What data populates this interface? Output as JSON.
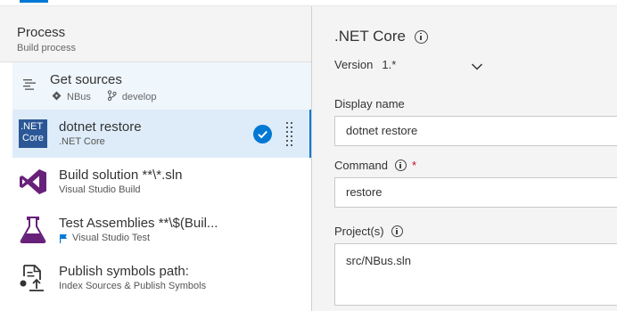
{
  "process": {
    "title": "Process",
    "subtitle": "Build process"
  },
  "get_sources": {
    "title": "Get sources",
    "repo": "NBus",
    "branch": "develop",
    "icon": "list-lines-icon"
  },
  "tasks": [
    {
      "title": "dotnet restore",
      "subtitle": ".NET Core",
      "icon": "dotnet-core-icon",
      "badge_line1": ".NET",
      "badge_line2": "Core",
      "selected": true
    },
    {
      "title": "Build solution **\\*.sln",
      "subtitle": "Visual Studio Build",
      "icon": "visual-studio-icon",
      "selected": false
    },
    {
      "title": "Test Assemblies **\\$(Buil...",
      "subtitle": "Visual Studio Test",
      "icon": "flask-icon",
      "selected": false
    },
    {
      "title": "Publish symbols path:",
      "subtitle": "Index Sources & Publish Symbols",
      "icon": "publish-symbols-icon",
      "selected": false
    }
  ],
  "details": {
    "title": ".NET Core",
    "version_label": "Version",
    "version_value": "1.*",
    "display_name_label": "Display name",
    "display_name_value": "dotnet restore",
    "command_label": "Command",
    "command_required": "*",
    "command_value": "restore",
    "projects_label": "Project(s)",
    "projects_value": "src/NBus.sln"
  },
  "colors": {
    "accent": "#0078d4",
    "selected_bg": "#deecf9",
    "visual_studio_purple": "#68217a",
    "netcore_blue": "#2b5797",
    "required_red": "#c50f1f"
  }
}
